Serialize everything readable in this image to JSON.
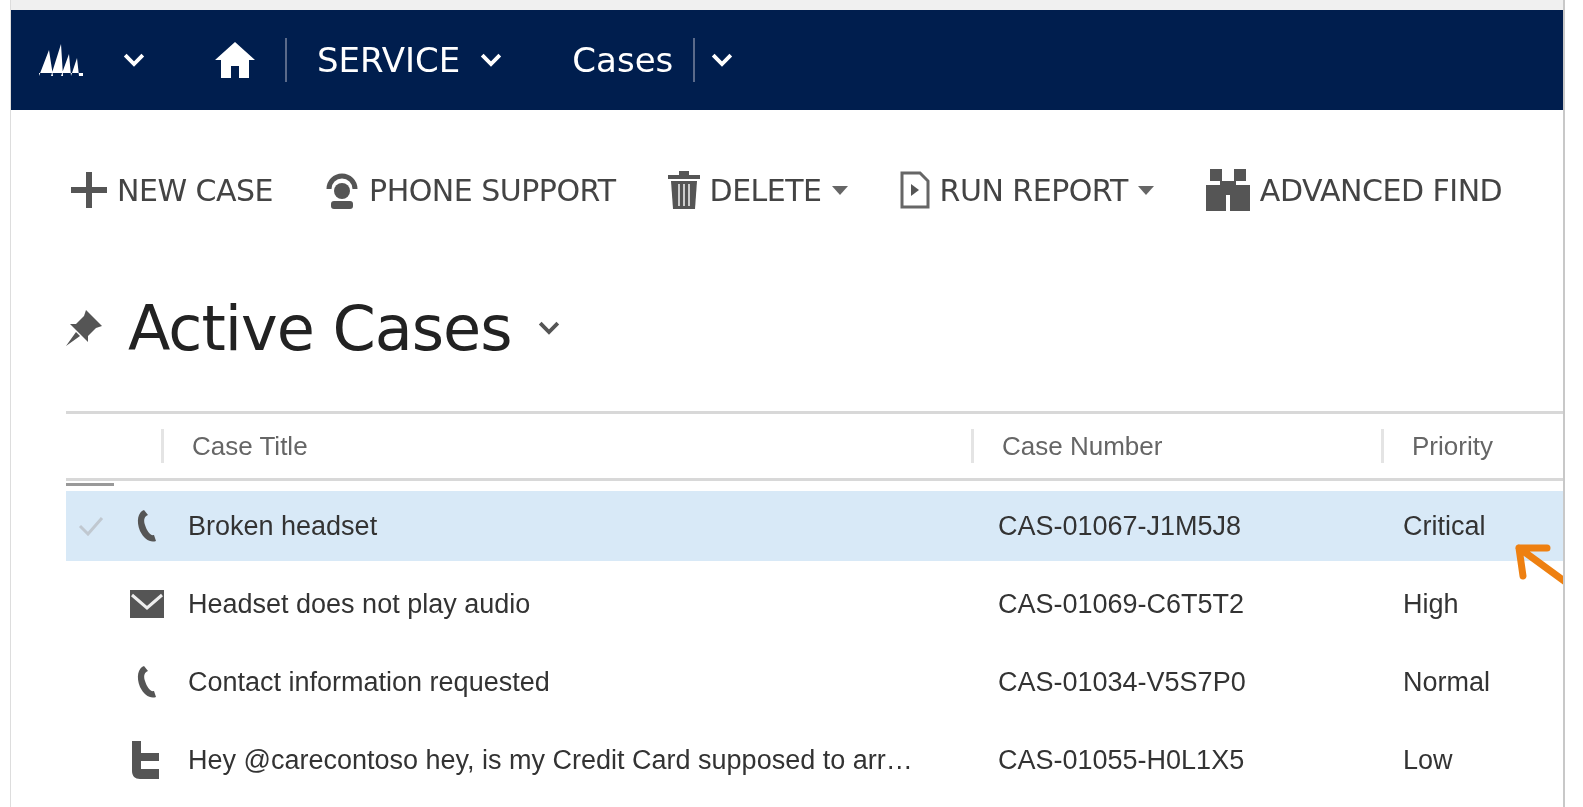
{
  "nav": {
    "area": "SERVICE",
    "entity": "Cases"
  },
  "commands": [
    {
      "label": "NEW CASE",
      "kind": "plus",
      "dropdown": false
    },
    {
      "label": "PHONE SUPPORT",
      "kind": "headset",
      "dropdown": false
    },
    {
      "label": "DELETE",
      "kind": "trash",
      "dropdown": true
    },
    {
      "label": "RUN REPORT",
      "kind": "report",
      "dropdown": true
    },
    {
      "label": "ADVANCED FIND",
      "kind": "binoculars",
      "dropdown": false
    }
  ],
  "view": {
    "title": "Active Cases"
  },
  "table": {
    "columns": [
      "Case Title",
      "Case Number",
      "Priority"
    ],
    "rows": [
      {
        "kind": "phone",
        "selected": true,
        "cells": [
          "Broken headset",
          "CAS-01067-J1M5J8",
          "Critical"
        ]
      },
      {
        "kind": "email",
        "selected": false,
        "cells": [
          "Headset does not play audio",
          "CAS-01069-C6T5T2",
          "High"
        ]
      },
      {
        "kind": "phone",
        "selected": false,
        "cells": [
          "Contact information requested",
          "CAS-01034-V5S7P0",
          "Normal"
        ]
      },
      {
        "kind": "twitter",
        "selected": false,
        "cells": [
          "Hey @carecontoso hey, is my Credit Card supposed to arr…",
          "CAS-01055-H0L1X5",
          "Low"
        ]
      }
    ]
  }
}
